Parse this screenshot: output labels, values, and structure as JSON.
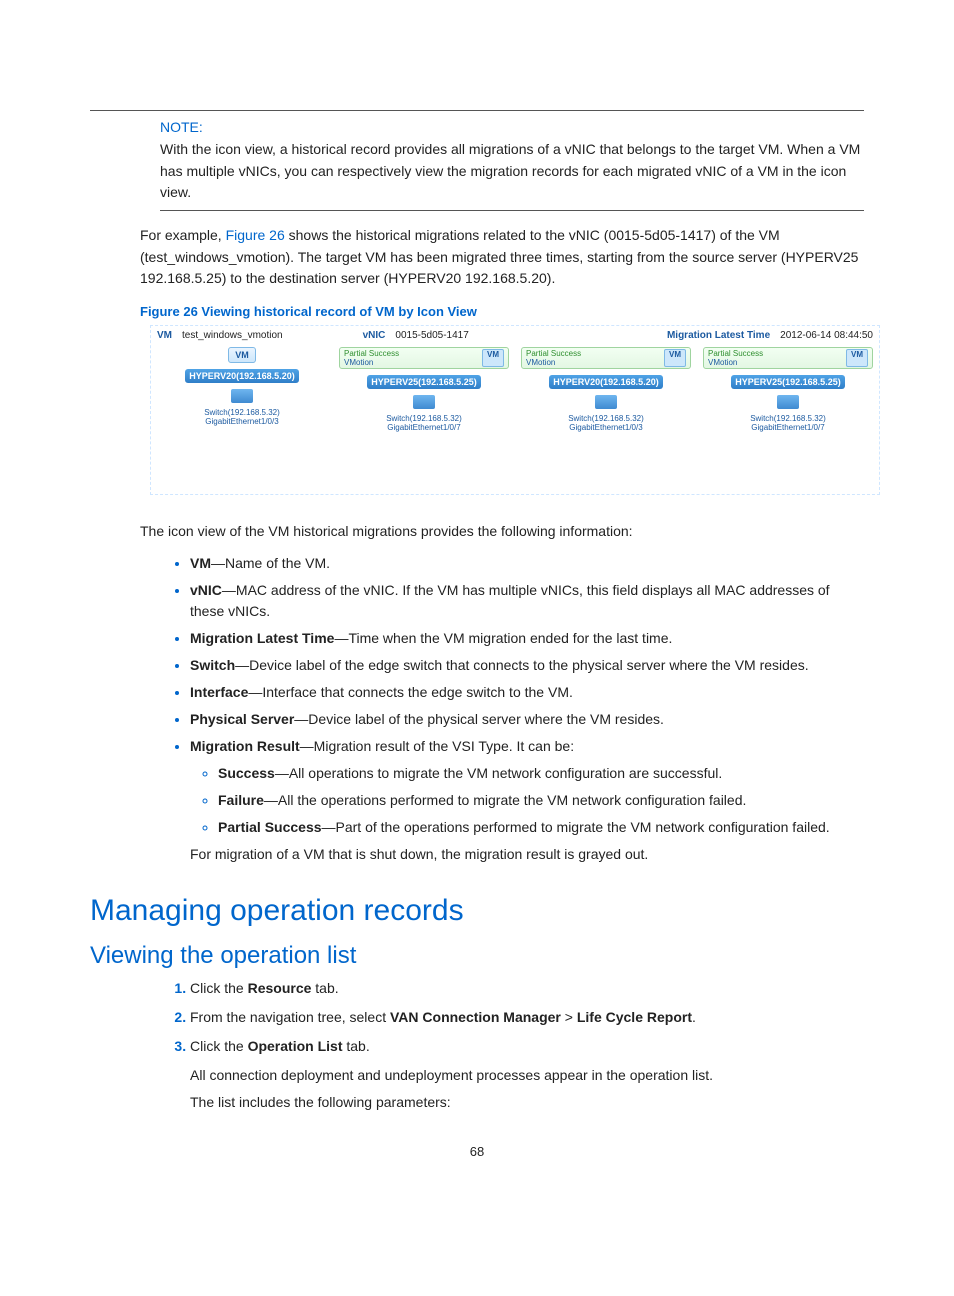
{
  "note": {
    "heading": "NOTE:",
    "body": "With the icon view, a historical record provides all migrations of a vNIC that belongs to the target VM. When a VM has multiple vNICs, you can respectively view the migration records for each migrated vNIC of a VM in the icon view."
  },
  "example": {
    "prefix": "For example, ",
    "figref": "Figure 26",
    "suffix": " shows the historical migrations related to the vNIC (0015-5d05-1417) of the VM (test_windows_vmotion). The target VM has been migrated three times, starting from the source server (HYPERV25 192.168.5.25) to the destination server (HYPERV20 192.168.5.20)."
  },
  "figure": {
    "caption": "Figure 26 Viewing historical record of VM by Icon View",
    "header": {
      "vm_label": "VM",
      "vm_value": "test_windows_vmotion",
      "vnic_label": "vNIC",
      "vnic_value": "0015-5d05-1417",
      "time_label": "Migration Latest Time",
      "time_value": "2012-06-14 08:44:50"
    },
    "cols": [
      {
        "badge": "",
        "vmtext": "VM",
        "server": "HYPERV20(192.168.5.20)",
        "switch": "Switch(192.168.5.32)",
        "iface": "GigabitEthernet1/0/3"
      },
      {
        "badge": "Partial Success",
        "sub": "VMotion",
        "vmtext": "VM",
        "server": "HYPERV25(192.168.5.25)",
        "switch": "Switch(192.168.5.32)",
        "iface": "GigabitEthernet1/0/7"
      },
      {
        "badge": "Partial Success",
        "sub": "VMotion",
        "vmtext": "VM",
        "server": "HYPERV20(192.168.5.20)",
        "switch": "Switch(192.168.5.32)",
        "iface": "GigabitEthernet1/0/3"
      },
      {
        "badge": "Partial Success",
        "sub": "VMotion",
        "vmtext": "VM",
        "server": "HYPERV25(192.168.5.25)",
        "switch": "Switch(192.168.5.32)",
        "iface": "GigabitEthernet1/0/7"
      }
    ]
  },
  "intro2": "The icon view of the VM historical migrations provides the following information:",
  "bullets": [
    {
      "term": "VM",
      "desc": "—Name of the VM."
    },
    {
      "term": "vNIC",
      "desc": "—MAC address of the vNIC. If the VM has multiple vNICs, this field displays all MAC addresses of these vNICs."
    },
    {
      "term": "Migration Latest Time",
      "desc": "—Time when the VM migration ended for the last time."
    },
    {
      "term": "Switch",
      "desc": "—Device label of the edge switch that connects to the physical server where the VM resides."
    },
    {
      "term": "Interface",
      "desc": "—Interface that connects the edge switch to the VM."
    },
    {
      "term": "Physical Server",
      "desc": "—Device label of the physical server where the VM resides."
    },
    {
      "term": "Migration Result",
      "desc": "—Migration result of the VSI Type. It can be:"
    }
  ],
  "subbullets": [
    {
      "term": "Success",
      "desc": "—All operations to migrate the VM network configuration are successful."
    },
    {
      "term": "Failure",
      "desc": "—All the operations performed to migrate the VM network configuration failed."
    },
    {
      "term": "Partial Success",
      "desc": "—Part of the operations performed to migrate the VM network configuration failed."
    }
  ],
  "tail": "For migration of a VM that is shut down, the migration result is grayed out.",
  "h1": "Managing operation records",
  "h2": "Viewing the operation list",
  "steps": [
    {
      "pre": "Click the ",
      "bold": "Resource",
      "post": " tab."
    },
    {
      "pre": "From the navigation tree, select ",
      "bold": "VAN Connection Manager",
      "mid": " > ",
      "bold2": "Life Cycle Report",
      "post": "."
    },
    {
      "pre": "Click the ",
      "bold": "Operation List",
      "post": " tab."
    }
  ],
  "after_steps": [
    "All connection deployment and undeployment processes appear in the operation list.",
    "The list includes the following parameters:"
  ],
  "pagenum": "68"
}
